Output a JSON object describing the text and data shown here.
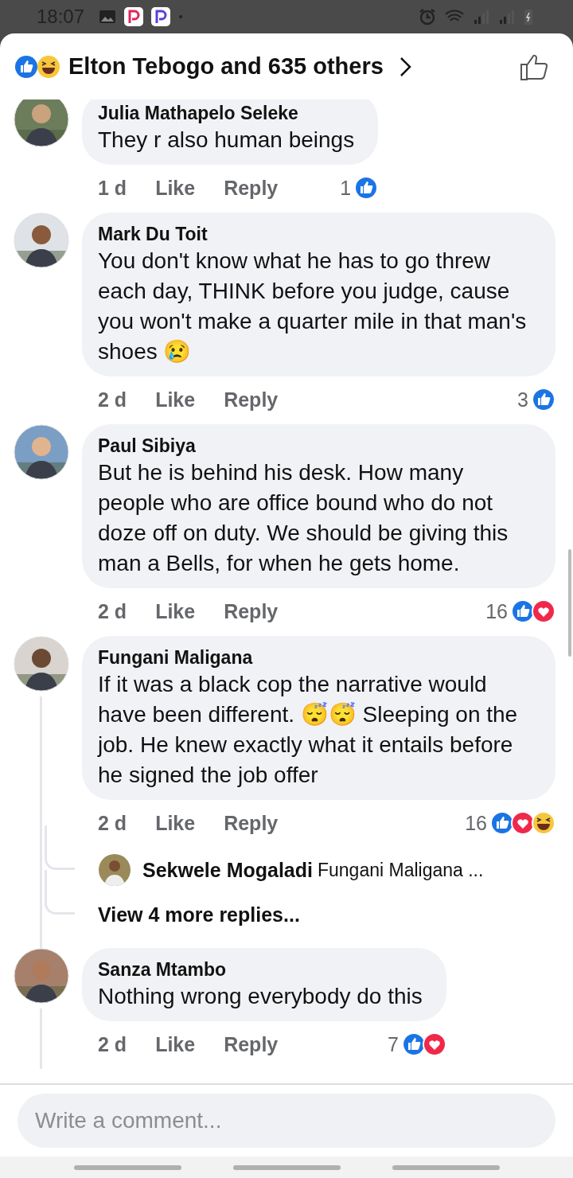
{
  "status_bar": {
    "time": "18:07"
  },
  "header": {
    "reactions": [
      {
        "kind": "like"
      },
      {
        "kind": "haha"
      }
    ],
    "title": "Elton Tebogo and 635 others"
  },
  "comments": [
    {
      "name": "Julia Mathapelo Seleke",
      "text": "They r also human beings",
      "time": "1 d",
      "like": "Like",
      "reply": "Reply",
      "count": "1",
      "reactions": [
        {
          "kind": "like"
        }
      ],
      "thread_line": false
    },
    {
      "name": "Mark Du Toit",
      "text": "You don't know what he has to go threw each day, THINK before you judge, cause you won't make a quarter mile in that man's shoes 😢",
      "time": "2 d",
      "like": "Like",
      "reply": "Reply",
      "count": "3",
      "reactions": [
        {
          "kind": "like"
        }
      ],
      "thread_line": false
    },
    {
      "name": "Paul Sibiya",
      "text": "But he is behind his desk. How many people who are office bound who do not doze off on duty. We should be giving this man a Bells, for when he gets home.",
      "time": "2 d",
      "like": "Like",
      "reply": "Reply",
      "count": "16",
      "reactions": [
        {
          "kind": "like"
        },
        {
          "kind": "love"
        }
      ],
      "thread_line": false
    },
    {
      "name": "Fungani Maligana",
      "text": "If it was a black cop the narrative would have been different. 😴😴 Sleeping on the job. He knew exactly what it entails before he signed the job offer",
      "time": "2 d",
      "like": "Like",
      "reply": "Reply",
      "count": "16",
      "reactions": [
        {
          "kind": "like"
        },
        {
          "kind": "love"
        },
        {
          "kind": "haha"
        }
      ],
      "thread_line": true,
      "replies": {
        "preview": {
          "name": "Sekwele Mogaladi",
          "text": "Fungani Maligana ..."
        },
        "more": "View 4 more replies..."
      }
    },
    {
      "name": "Sanza Mtambo",
      "text": "Nothing wrong everybody do this",
      "time": "2 d",
      "like": "Like",
      "reply": "Reply",
      "count": "7",
      "reactions": [
        {
          "kind": "like"
        },
        {
          "kind": "love"
        }
      ],
      "thread_line": true
    }
  ],
  "composer": {
    "placeholder": "Write a comment..."
  }
}
